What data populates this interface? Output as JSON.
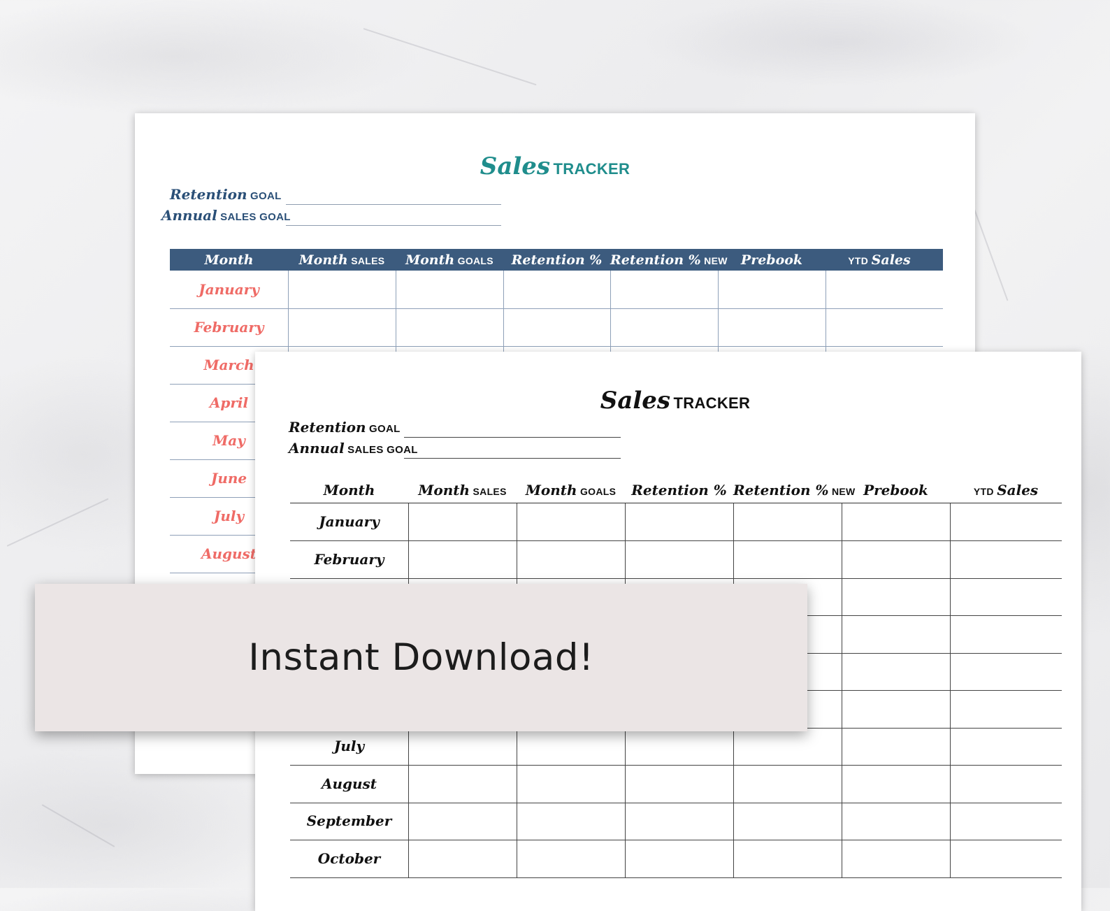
{
  "back_sheet": {
    "title_script": "Sales",
    "title_caps": "TRACKER",
    "goals": [
      {
        "script": "Retention",
        "caps": "GOAL"
      },
      {
        "script": "Annual",
        "caps": "SALES GOAL"
      }
    ],
    "columns": [
      {
        "script": "Month",
        "caps": ""
      },
      {
        "script": "Month",
        "caps": "SALES"
      },
      {
        "script": "Month",
        "caps": "GOALS"
      },
      {
        "script": "Retention %",
        "caps": ""
      },
      {
        "script": "Retention %",
        "caps": "NEW"
      },
      {
        "script": "Prebook",
        "caps": ""
      },
      {
        "caps_first": "YTD",
        "script": "Sales"
      }
    ],
    "months": [
      "January",
      "February",
      "March",
      "April",
      "May",
      "June",
      "July",
      "August"
    ]
  },
  "front_sheet": {
    "title_script": "Sales",
    "title_caps": "TRACKER",
    "goals": [
      {
        "script": "Retention",
        "caps": "GOAL"
      },
      {
        "script": "Annual",
        "caps": "SALES GOAL"
      }
    ],
    "columns": [
      {
        "script": "Month",
        "caps": ""
      },
      {
        "script": "Month",
        "caps": "SALES"
      },
      {
        "script": "Month",
        "caps": "GOALS"
      },
      {
        "script": "Retention %",
        "caps": ""
      },
      {
        "script": "Retention %",
        "caps": "NEW"
      },
      {
        "script": "Prebook",
        "caps": ""
      },
      {
        "caps_first": "YTD",
        "script": "Sales"
      }
    ],
    "months": [
      "January",
      "February",
      "",
      "",
      "",
      "",
      "July",
      "August",
      "September",
      "October"
    ]
  },
  "banner": {
    "text": "Instant Download!"
  },
  "colors": {
    "teal_title": "#1f8d8c",
    "navy_header": "#3c5b7e",
    "coral_month": "#ef6b66",
    "banner_bg": "#ebe5e5"
  }
}
